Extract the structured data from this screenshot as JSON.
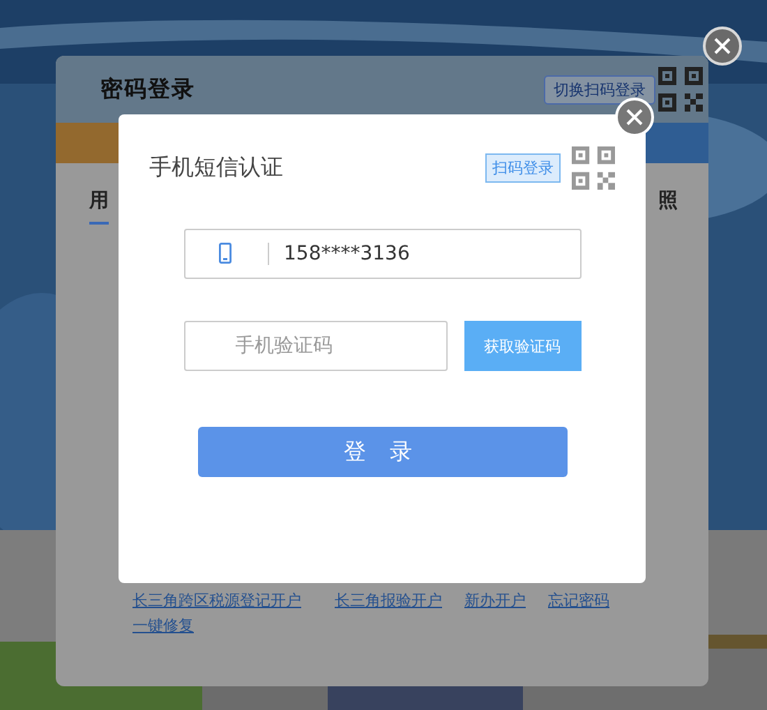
{
  "back_dialog": {
    "title": "密码登录",
    "switch_button": "切换扫码登录",
    "tab_fragments": [
      "用",
      "照"
    ],
    "links": [
      "长三角跨区税源登记开户",
      "长三角报验开户",
      "新办开户",
      "忘记密码",
      "一键修复"
    ]
  },
  "sms_dialog": {
    "title": "手机短信认证",
    "scan_button": "扫码登录",
    "phone_field": {
      "value": "158****3136"
    },
    "code_field": {
      "placeholder": "手机验证码"
    },
    "get_code_button": "获取验证码",
    "login_button": "登 录"
  }
}
